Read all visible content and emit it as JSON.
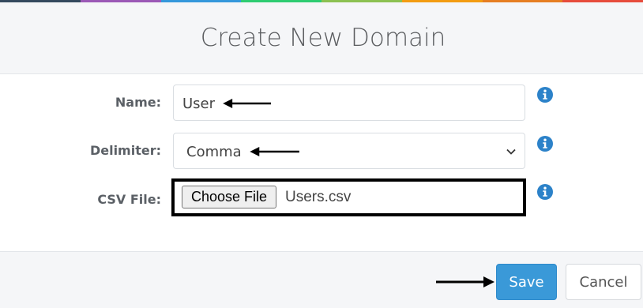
{
  "dialog": {
    "title": "Create New Domain"
  },
  "form": {
    "name": {
      "label": "Name:",
      "value": "User"
    },
    "delimiter": {
      "label": "Delimiter:",
      "selected": "Comma"
    },
    "csv_file": {
      "label": "CSV File:",
      "button_label": "Choose File",
      "file_name": "Users.csv"
    }
  },
  "footer": {
    "save_label": "Save",
    "cancel_label": "Cancel"
  },
  "colors": {
    "accent": "#3a99d8",
    "info_icon": "#2c82c9",
    "top_strip": [
      "#34495e",
      "#9b59b6",
      "#3498db",
      "#2ecc71",
      "#8cc152",
      "#f39c12",
      "#e67e22",
      "#e74c3c"
    ]
  },
  "icons": {
    "info": "info-circle-icon",
    "caret": "chevron-down-icon",
    "annotation_arrow": "arrow-icon"
  }
}
